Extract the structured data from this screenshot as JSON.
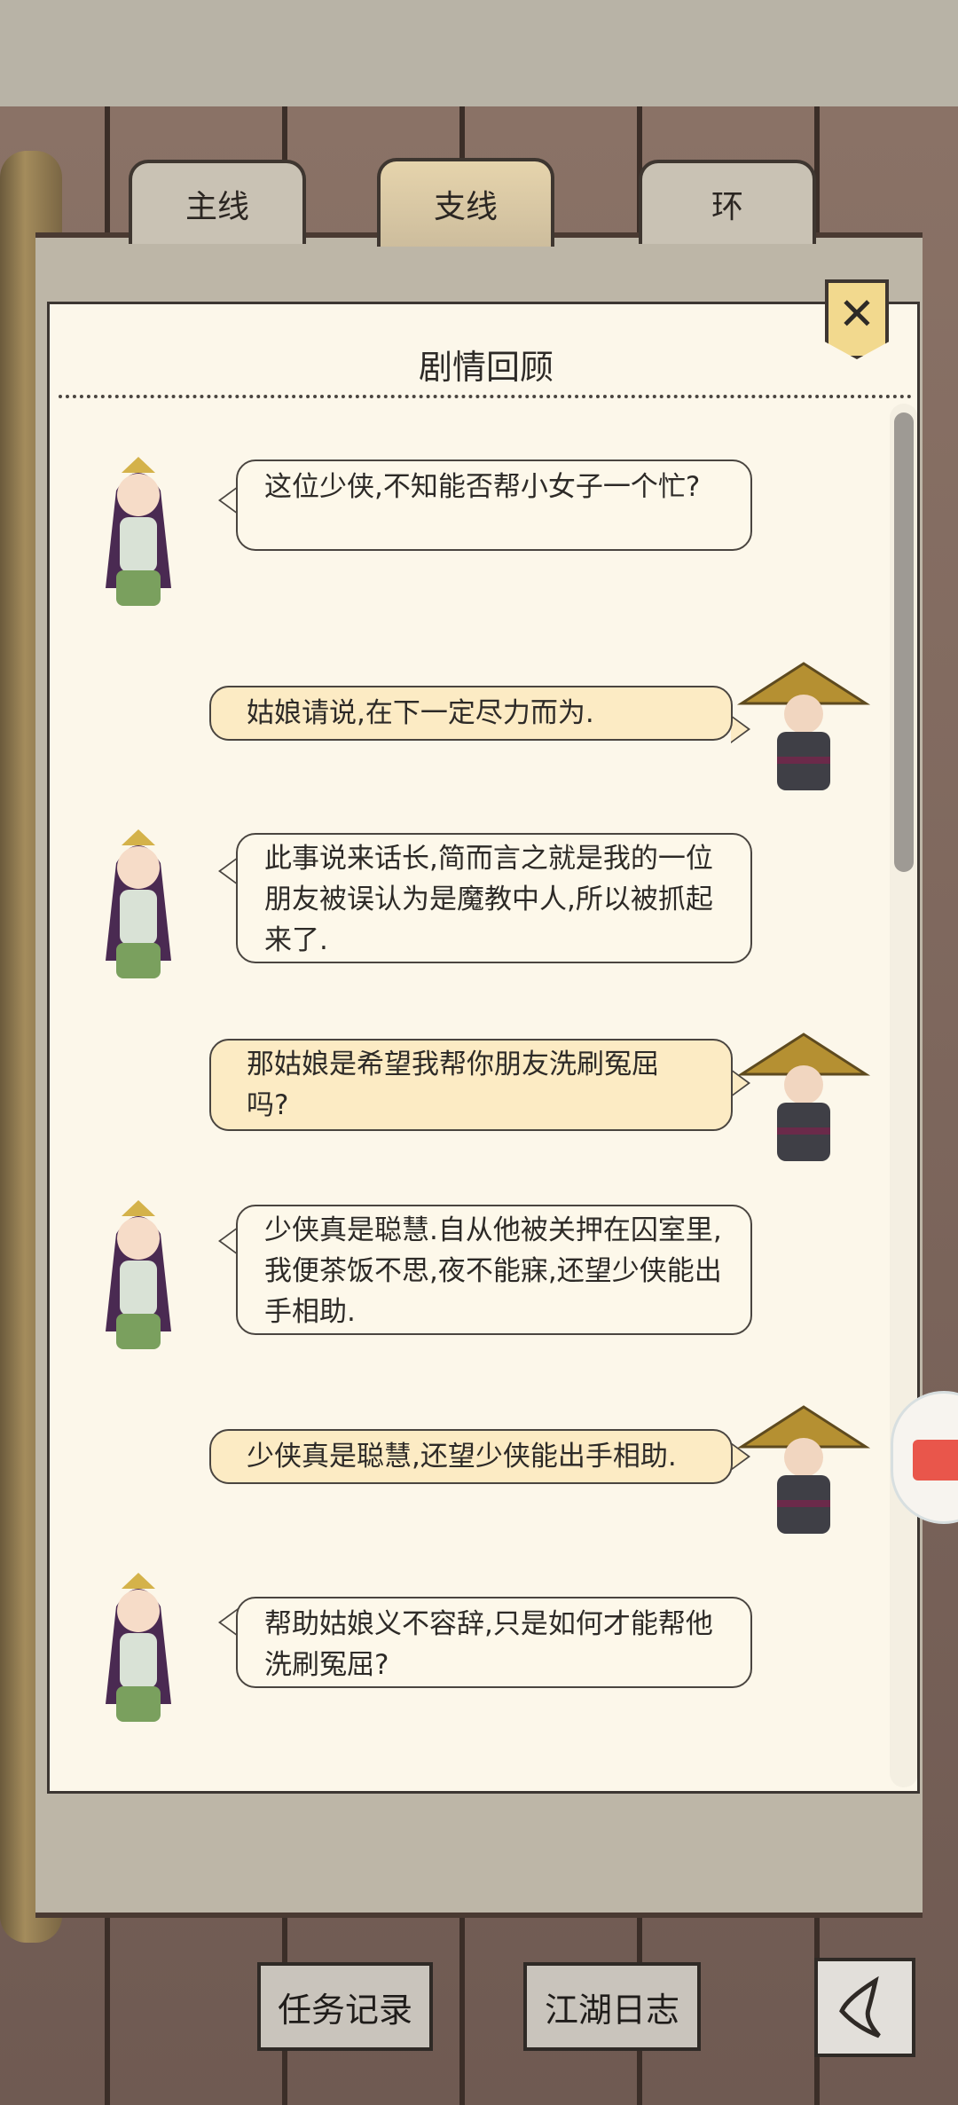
{
  "tabs": [
    {
      "label": "主线",
      "active": false
    },
    {
      "label": "支线",
      "active": true
    },
    {
      "label": "环",
      "active": false
    }
  ],
  "panel": {
    "title": "剧情回顾",
    "close_icon": "close-icon"
  },
  "messages": [
    {
      "speaker": "female",
      "side": "left",
      "text": "这位少侠,不知能否帮小女子一个忙?"
    },
    {
      "speaker": "male",
      "side": "right",
      "text": "姑娘请说,在下一定尽力而为."
    },
    {
      "speaker": "female",
      "side": "left",
      "text": "此事说来话长,简而言之就是我的一位朋友被误认为是魔教中人,所以被抓起来了."
    },
    {
      "speaker": "male",
      "side": "right",
      "text": "那姑娘是希望我帮你朋友洗刷冤屈吗?"
    },
    {
      "speaker": "female",
      "side": "left",
      "text": "少侠真是聪慧.自从他被关押在囚室里,我便茶饭不思,夜不能寐,还望少侠能出手相助."
    },
    {
      "speaker": "male",
      "side": "right",
      "text": "少侠真是聪慧,还望少侠能出手相助."
    },
    {
      "speaker": "female",
      "side": "left",
      "text": "帮助姑娘义不容辞,只是如何才能帮他洗刷冤屈?"
    }
  ],
  "bottom": {
    "task_record": "任务记录",
    "jianghu_log": "江湖日志",
    "back_icon": "back-icon"
  },
  "colors": {
    "panel_bg": "#fcf7ea",
    "right_bubble_bg": "#fcebc4",
    "active_tab": "#e6d4ac"
  }
}
